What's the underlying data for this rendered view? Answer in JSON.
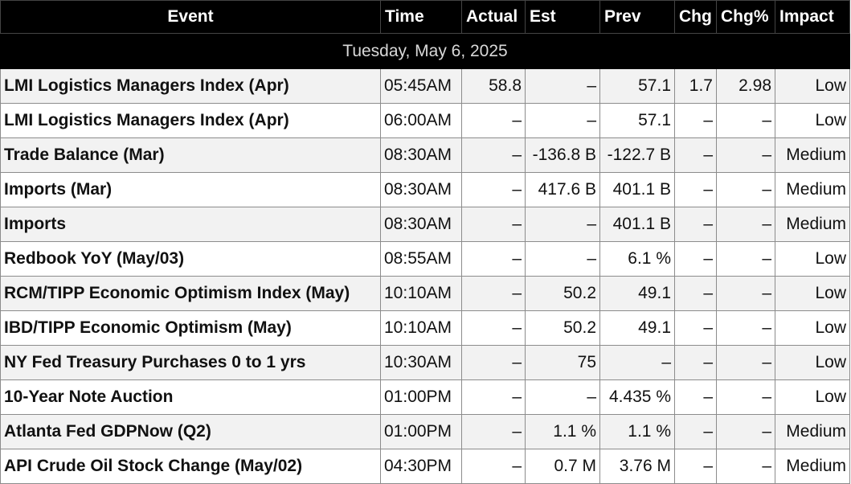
{
  "headers": {
    "event": "Event",
    "time": "Time",
    "actual": "Actual",
    "est": "Est",
    "prev": "Prev",
    "chg": "Chg",
    "chg_pct": "Chg%",
    "impact": "Impact"
  },
  "date_label": "Tuesday, May 6, 2025",
  "rows": [
    {
      "event": "LMI Logistics Managers Index (Apr)",
      "time": "05:45AM",
      "actual": "58.8",
      "est": "–",
      "prev": "57.1",
      "chg": "1.7",
      "chg_pct": "2.98",
      "impact": "Low"
    },
    {
      "event": "LMI Logistics Managers Index (Apr)",
      "time": "06:00AM",
      "actual": "–",
      "est": "–",
      "prev": "57.1",
      "chg": "–",
      "chg_pct": "–",
      "impact": "Low"
    },
    {
      "event": "Trade Balance (Mar)",
      "time": "08:30AM",
      "actual": "–",
      "est": "-136.8 B",
      "prev": "-122.7 B",
      "chg": "–",
      "chg_pct": "–",
      "impact": "Medium"
    },
    {
      "event": "Imports (Mar)",
      "time": "08:30AM",
      "actual": "–",
      "est": "417.6 B",
      "prev": "401.1 B",
      "chg": "–",
      "chg_pct": "–",
      "impact": "Medium"
    },
    {
      "event": "Imports",
      "time": "08:30AM",
      "actual": "–",
      "est": "–",
      "prev": "401.1 B",
      "chg": "–",
      "chg_pct": "–",
      "impact": "Medium"
    },
    {
      "event": "Redbook YoY (May/03)",
      "time": "08:55AM",
      "actual": "–",
      "est": "–",
      "prev": "6.1 %",
      "chg": "–",
      "chg_pct": "–",
      "impact": "Low"
    },
    {
      "event": "RCM/TIPP Economic Optimism Index (May)",
      "time": "10:10AM",
      "actual": "–",
      "est": "50.2",
      "prev": "49.1",
      "chg": "–",
      "chg_pct": "–",
      "impact": "Low"
    },
    {
      "event": "IBD/TIPP Economic Optimism (May)",
      "time": "10:10AM",
      "actual": "–",
      "est": "50.2",
      "prev": "49.1",
      "chg": "–",
      "chg_pct": "–",
      "impact": "Low"
    },
    {
      "event": "NY Fed Treasury Purchases 0 to 1 yrs",
      "time": "10:30AM",
      "actual": "–",
      "est": "75",
      "prev": "–",
      "chg": "–",
      "chg_pct": "–",
      "impact": "Low"
    },
    {
      "event": "10-Year Note Auction",
      "time": "01:00PM",
      "actual": "–",
      "est": "–",
      "prev": "4.435 %",
      "chg": "–",
      "chg_pct": "–",
      "impact": "Low"
    },
    {
      "event": "Atlanta Fed GDPNow (Q2)",
      "time": "01:00PM",
      "actual": "–",
      "est": "1.1 %",
      "prev": "1.1 %",
      "chg": "–",
      "chg_pct": "–",
      "impact": "Medium"
    },
    {
      "event": "API Crude Oil Stock Change (May/02)",
      "time": "04:30PM",
      "actual": "–",
      "est": "0.7 M",
      "prev": "3.76 M",
      "chg": "–",
      "chg_pct": "–",
      "impact": "Medium"
    }
  ]
}
